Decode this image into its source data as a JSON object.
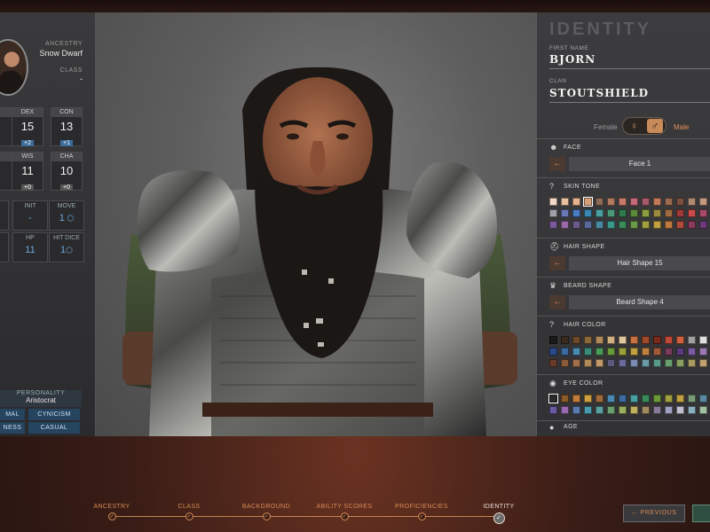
{
  "left_panel": {
    "ancestry_label": "ANCESTRY",
    "ancestry_value": "Snow Dwarf",
    "class_label": "CLASS",
    "class_value": "-",
    "abilities": [
      {
        "name": "DEX",
        "score": "15",
        "mod": "+2"
      },
      {
        "name": "CON",
        "score": "13",
        "mod": "+1"
      },
      {
        "name": "WIS",
        "score": "11",
        "mod": "+0"
      },
      {
        "name": "CHA",
        "score": "10",
        "mod": "+0"
      }
    ],
    "secondary": [
      {
        "name": "INIT",
        "value": "-"
      },
      {
        "name": "MOVE",
        "value": "1"
      },
      {
        "name": "HP",
        "value": "11"
      },
      {
        "name": "HIT DICE",
        "value": "1"
      }
    ],
    "personality_label": "PERSONALITY",
    "personality_value": "Aristocrat",
    "traits": [
      "MAL",
      "CYNICISM",
      "NESS",
      "CASUAL"
    ]
  },
  "identity": {
    "title": "IDENTITY",
    "first_name_label": "FIRST NAME",
    "first_name": "BJORN",
    "clan_label": "CLAN",
    "clan": "STOUTSHIELD",
    "female_label": "Female",
    "male_label": "Male",
    "female_symbol": "♀",
    "male_symbol": "♂"
  },
  "sections": {
    "face": {
      "label": "FACE",
      "value": "Face 1"
    },
    "skin_tone": {
      "label": "SKIN TONE"
    },
    "hair_shape": {
      "label": "HAIR SHAPE",
      "value": "Hair Shape 15"
    },
    "beard_shape": {
      "label": "BEARD SHAPE",
      "value": "Beard Shape 4"
    },
    "hair_color": {
      "label": "HAIR COLOR"
    },
    "eye_color": {
      "label": "EYE COLOR"
    },
    "age": {
      "label": "AGE"
    }
  },
  "palettes": {
    "skin_tone": [
      "#f3d8c8",
      "#e9c0a2",
      "#e6b28f",
      "#d8a17a",
      "#8b6b5a",
      "#b07a5f",
      "#c87a6a",
      "#c46a7a",
      "#a55a6a",
      "#c27a5a",
      "#9a6a50",
      "#7a5040",
      "#b08a70",
      "#c49a80",
      "#a0a0a8",
      "#6a78b8",
      "#4a7ac0",
      "#3a88b0",
      "#4aa0a0",
      "#4a9a78",
      "#2f7a4a",
      "#5a8a3a",
      "#8aa040",
      "#9a8a40",
      "#a06a40",
      "#a03a3a",
      "#c84a4a",
      "#a84a6a",
      "#7a5a9a",
      "#9a6aa8",
      "#6a5a8a",
      "#5a6a9a",
      "#4a8aa0",
      "#3a9a8a",
      "#3a8a5a",
      "#6a9a4a",
      "#a0a040",
      "#c0a040",
      "#c07a40",
      "#b04a3a",
      "#8a3a5a",
      "#6a3a7a"
    ],
    "hair_color": [
      "#1a1a1a",
      "#3a2a1e",
      "#6a4a2a",
      "#8a6a3a",
      "#b08a5a",
      "#d0b080",
      "#e0c8a0",
      "#c87040",
      "#a04a2a",
      "#7a2a1a",
      "#c04a3a",
      "#d06040",
      "#a0a0a0",
      "#e0e0e0",
      "#2a4a8a",
      "#3a6aa0",
      "#4a8ab0",
      "#3a8a7a",
      "#4a9a5a",
      "#6a9a3a",
      "#9aa03a",
      "#c0a040",
      "#c08040",
      "#a05a3a",
      "#7a3a5a",
      "#5a3a7a",
      "#7a5aa0",
      "#9a7ab0",
      "#6a3a2a",
      "#8a5a3a",
      "#a0704a",
      "#b08a5a",
      "#c09a6a",
      "#5a5a7a",
      "#6a6a9a",
      "#7a8ab0",
      "#6a9aa8",
      "#5a9a8a",
      "#6aa070",
      "#8aa060",
      "#a89a60",
      "#c0a070"
    ],
    "eye_color": [
      "#2a2a2a",
      "#8a5a2a",
      "#c07a3a",
      "#d0a040",
      "#a06a3a",
      "#4a8ab0",
      "#3a6aa0",
      "#4aa0a0",
      "#3a8a5a",
      "#6a9a3a",
      "#a0a040",
      "#c0a040",
      "#7a9a7a",
      "#5a8aa0",
      "#6a5aa0",
      "#9a6ab0",
      "#5a7ab0",
      "#4a9ab0",
      "#5aa0a0",
      "#6aa070",
      "#9ab060",
      "#c0b060",
      "#a08a60",
      "#8a7a9a",
      "#a0a0c0",
      "#c0c0d0",
      "#8ab0c0",
      "#a0c0a0"
    ]
  },
  "steps": [
    {
      "label": "ANCESTRY",
      "state": "done"
    },
    {
      "label": "CLASS",
      "state": "done"
    },
    {
      "label": "BACKGROUND",
      "state": "done"
    },
    {
      "label": "ABILITY SCORES",
      "state": "done"
    },
    {
      "label": "PROFICIENCIES",
      "state": "done"
    },
    {
      "label": "IDENTITY",
      "state": "current"
    }
  ],
  "buttons": {
    "previous": "PREVIOUS",
    "next": ""
  },
  "icons": {
    "arrow_left": "←",
    "check": "✓",
    "dice": "⬡"
  },
  "colors": {
    "accent": "#d78a52",
    "stat_blue": "#6fa7d8",
    "trait_bg": "#24445f"
  }
}
